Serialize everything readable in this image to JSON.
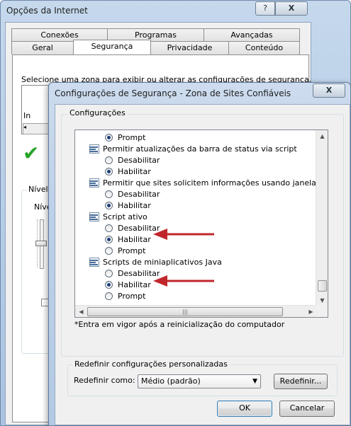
{
  "bg_window": {
    "title": "Opções da Internet",
    "help_button": "?",
    "close_button": "X",
    "tabs_row1": [
      "Conexões",
      "Programas",
      "Avançadas"
    ],
    "tabs_row2": [
      "Geral",
      "Segurança",
      "Privacidade",
      "Conteúdo"
    ],
    "zone_prompt": "Selecione uma zona para exibir ou alterar as configurações de segurança.",
    "zone_partial": "In",
    "level_partial": "Nível d",
    "level_partial2": "Níve"
  },
  "dialog": {
    "title": "Configurações de Segurança - Zona de Sites Confiáveis",
    "close_button": "X",
    "settings_group": "Configurações",
    "list_items": [
      {
        "kind": "radio",
        "label": "Prompt",
        "selected": true
      },
      {
        "kind": "header",
        "label": "Permitir atualizações da barra de status via script"
      },
      {
        "kind": "radio",
        "label": "Desabilitar",
        "selected": false
      },
      {
        "kind": "radio",
        "label": "Habilitar",
        "selected": true
      },
      {
        "kind": "header",
        "label": "Permitir que sites solicitem informações usando janelas contro"
      },
      {
        "kind": "radio",
        "label": "Desabilitar",
        "selected": false
      },
      {
        "kind": "radio",
        "label": "Habilitar",
        "selected": true
      },
      {
        "kind": "header",
        "label": "Script ativo"
      },
      {
        "kind": "radio",
        "label": "Desabilitar",
        "selected": false
      },
      {
        "kind": "radio",
        "label": "Habilitar",
        "selected": true
      },
      {
        "kind": "radio",
        "label": "Prompt",
        "selected": false
      },
      {
        "kind": "header",
        "label": "Scripts de miniaplicativos Java"
      },
      {
        "kind": "radio",
        "label": "Desabilitar",
        "selected": false
      },
      {
        "kind": "radio",
        "label": "Habilitar",
        "selected": true
      },
      {
        "kind": "radio",
        "label": "Prompt",
        "selected": false
      }
    ],
    "restart_note": "*Entra em vigor após a reinicialização do computador",
    "reset_group": "Redefinir configurações personalizadas",
    "reset_label": "Redefinir como:",
    "reset_select": "Médio (padrão)",
    "reset_button": "Redefinir...",
    "ok_button": "OK",
    "cancel_button": "Cancelar",
    "annotation_color": "#c0272d"
  }
}
